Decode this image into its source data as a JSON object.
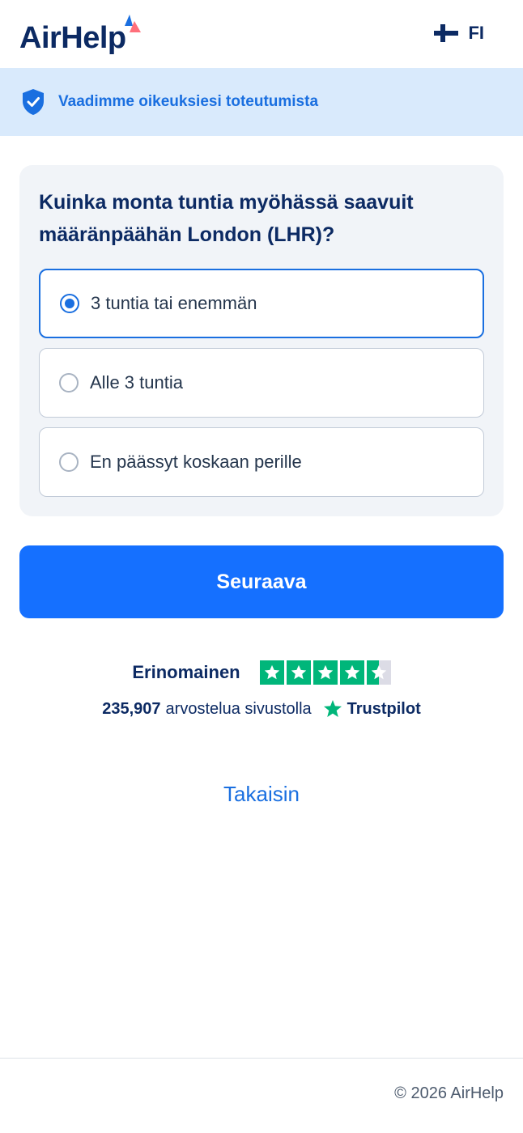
{
  "header": {
    "logo_text": "AirHelp",
    "language_code": "FI",
    "flag_icon": "finland-flag-icon"
  },
  "banner": {
    "icon": "shield-check-icon",
    "text": "Vaadimme oikeuksiesi toteutumista"
  },
  "question": {
    "text": "Kuinka monta tuntia myöhässä saavuit määränpäähän London (LHR)?",
    "options": [
      {
        "label": "3 tuntia tai enemmän",
        "selected": true
      },
      {
        "label": "Alle 3 tuntia",
        "selected": false
      },
      {
        "label": "En päässyt koskaan perille",
        "selected": false
      }
    ]
  },
  "next_button": {
    "label": "Seuraava"
  },
  "trustpilot": {
    "rating_text": "Erinomainen",
    "stars": 4.5,
    "review_count": "235,907",
    "review_text": "arvostelua sivustolla",
    "brand": "Trustpilot"
  },
  "back_link": {
    "label": "Takaisin"
  },
  "footer": {
    "copyright": "© 2026 AirHelp"
  },
  "colors": {
    "primary": "#1570ff",
    "navy": "#0c2a63",
    "banner_bg": "#d9eafc",
    "trustpilot_green": "#00b67a"
  }
}
